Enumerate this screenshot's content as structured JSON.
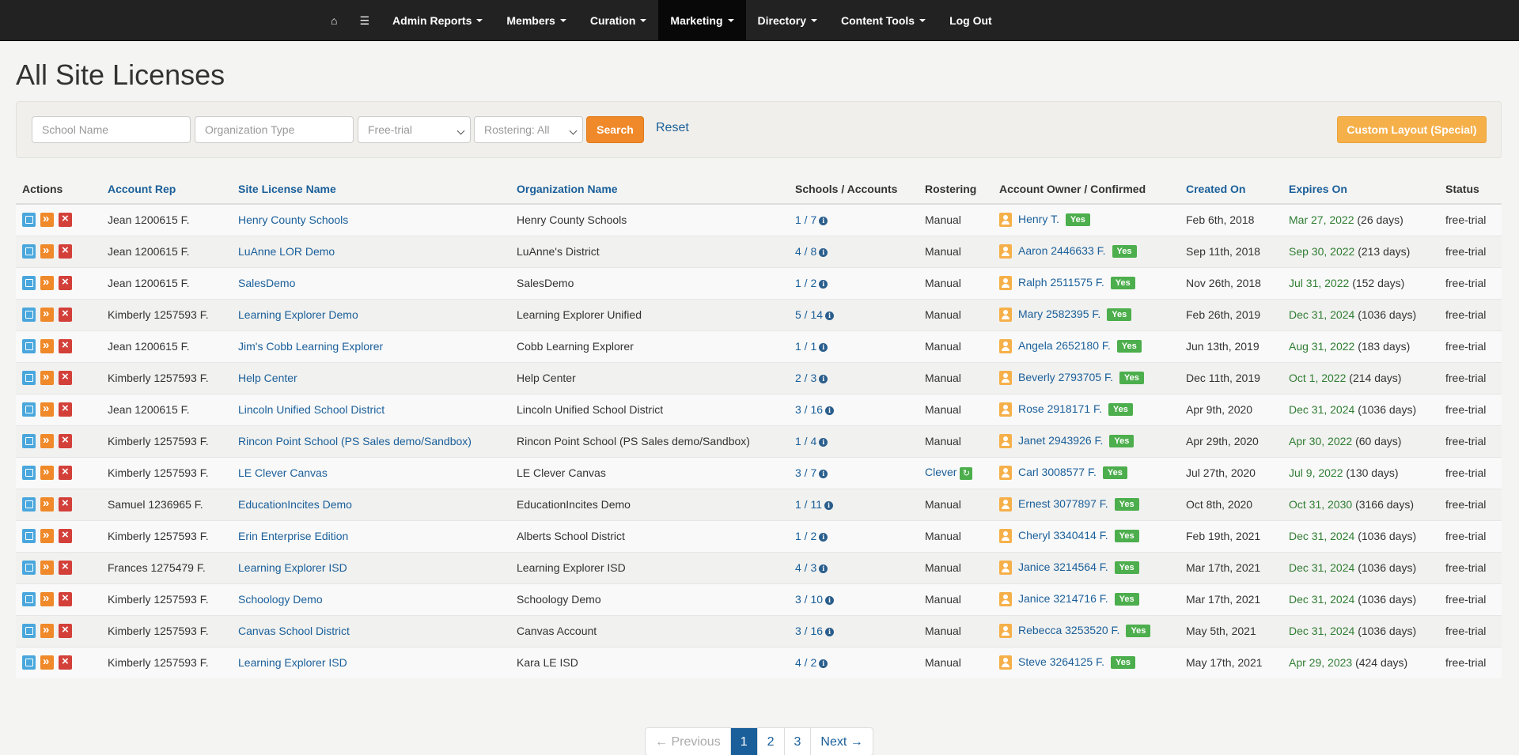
{
  "nav": {
    "home_icon": "home-icon",
    "list_icon": "list-icon",
    "items": [
      {
        "label": "Admin Reports"
      },
      {
        "label": "Members"
      },
      {
        "label": "Curation"
      },
      {
        "label": "Marketing"
      },
      {
        "label": "Directory"
      },
      {
        "label": "Content Tools"
      },
      {
        "label": "Log Out"
      }
    ]
  },
  "page": {
    "title": "All Site Licenses"
  },
  "filters": {
    "school_placeholder": "School Name",
    "org_type_placeholder": "Organization Type",
    "license_type_value": "Free-trial",
    "rostering_value": "Rostering: All",
    "search_label": "Search",
    "reset_label": "Reset",
    "custom_layout_label": "Custom Layout (Special)"
  },
  "table": {
    "headers": {
      "actions": "Actions",
      "account_rep": "Account Rep",
      "site_license_name": "Site License Name",
      "organization_name": "Organization Name",
      "schools_accounts": "Schools / Accounts",
      "rostering": "Rostering",
      "account_owner": "Account Owner / Confirmed",
      "created_on": "Created On",
      "expires_on": "Expires On",
      "status": "Status"
    },
    "rows": [
      {
        "rep": "Jean 1200615 F.",
        "license": "Henry County Schools",
        "org": "Henry County Schools",
        "counts": "1 / 7",
        "rostering": "Manual",
        "owner": "Henry T.",
        "confirmed": "Yes",
        "created": "Feb 6th, 2018",
        "expires": "Mar 27, 2022",
        "days": "(26 days)",
        "status": "free-trial"
      },
      {
        "rep": "Jean 1200615 F.",
        "license": "LuAnne LOR Demo",
        "org": "LuAnne's District",
        "counts": "4 / 8",
        "rostering": "Manual",
        "owner": "Aaron 2446633 F.",
        "confirmed": "Yes",
        "created": "Sep 11th, 2018",
        "expires": "Sep 30, 2022",
        "days": "(213 days)",
        "status": "free-trial"
      },
      {
        "rep": "Jean 1200615 F.",
        "license": "SalesDemo",
        "org": "SalesDemo",
        "counts": "1 / 2",
        "rostering": "Manual",
        "owner": "Ralph 2511575 F.",
        "confirmed": "Yes",
        "created": "Nov 26th, 2018",
        "expires": "Jul 31, 2022",
        "days": "(152 days)",
        "status": "free-trial"
      },
      {
        "rep": "Kimberly 1257593 F.",
        "license": "Learning Explorer Demo",
        "org": "Learning Explorer Unified",
        "counts": "5 / 14",
        "rostering": "Manual",
        "owner": "Mary 2582395 F.",
        "confirmed": "Yes",
        "created": "Feb 26th, 2019",
        "expires": "Dec 31, 2024",
        "days": "(1036 days)",
        "status": "free-trial"
      },
      {
        "rep": "Jean 1200615 F.",
        "license": "Jim's Cobb Learning Explorer",
        "org": "Cobb Learning Explorer",
        "counts": "1 / 1",
        "rostering": "Manual",
        "owner": "Angela 2652180 F.",
        "confirmed": "Yes",
        "created": "Jun 13th, 2019",
        "expires": "Aug 31, 2022",
        "days": "(183 days)",
        "status": "free-trial"
      },
      {
        "rep": "Kimberly 1257593 F.",
        "license": "Help Center",
        "org": "Help Center",
        "counts": "2 / 3",
        "rostering": "Manual",
        "owner": "Beverly 2793705 F.",
        "confirmed": "Yes",
        "created": "Dec 11th, 2019",
        "expires": "Oct 1, 2022",
        "days": "(214 days)",
        "status": "free-trial"
      },
      {
        "rep": "Jean 1200615 F.",
        "license": "Lincoln Unified School District",
        "org": "Lincoln Unified School District",
        "counts": "3 / 16",
        "rostering": "Manual",
        "owner": "Rose 2918171 F.",
        "confirmed": "Yes",
        "created": "Apr 9th, 2020",
        "expires": "Dec 31, 2024",
        "days": "(1036 days)",
        "status": "free-trial"
      },
      {
        "rep": "Kimberly 1257593 F.",
        "license": "Rincon Point School (PS Sales demo/Sandbox)",
        "org": "Rincon Point School (PS Sales demo/Sandbox)",
        "counts": "1 / 4",
        "rostering": "Manual",
        "owner": "Janet 2943926 F.",
        "confirmed": "Yes",
        "created": "Apr 29th, 2020",
        "expires": "Apr 30, 2022",
        "days": "(60 days)",
        "status": "free-trial"
      },
      {
        "rep": "Kimberly 1257593 F.",
        "license": "LE Clever Canvas",
        "org": "LE Clever Canvas",
        "counts": "3 / 7",
        "rostering": "Clever",
        "owner": "Carl 3008577 F.",
        "confirmed": "Yes",
        "created": "Jul 27th, 2020",
        "expires": "Jul 9, 2022",
        "days": "(130 days)",
        "status": "free-trial"
      },
      {
        "rep": "Samuel 1236965 F.",
        "license": "EducationIncites Demo",
        "org": "EducationIncites Demo",
        "counts": "1 / 11",
        "rostering": "Manual",
        "owner": "Ernest 3077897 F.",
        "confirmed": "Yes",
        "created": "Oct 8th, 2020",
        "expires": "Oct 31, 2030",
        "days": "(3166 days)",
        "status": "free-trial"
      },
      {
        "rep": "Kimberly 1257593 F.",
        "license": "Erin Enterprise Edition",
        "org": "Alberts School District",
        "counts": "1 / 2",
        "rostering": "Manual",
        "owner": "Cheryl 3340414 F.",
        "confirmed": "Yes",
        "created": "Feb 19th, 2021",
        "expires": "Dec 31, 2024",
        "days": "(1036 days)",
        "status": "free-trial"
      },
      {
        "rep": "Frances 1275479 F.",
        "license": "Learning Explorer ISD",
        "org": "Learning Explorer ISD",
        "counts": "4 / 3",
        "rostering": "Manual",
        "owner": "Janice 3214564 F.",
        "confirmed": "Yes",
        "created": "Mar 17th, 2021",
        "expires": "Dec 31, 2024",
        "days": "(1036 days)",
        "status": "free-trial"
      },
      {
        "rep": "Kimberly 1257593 F.",
        "license": "Schoology Demo",
        "org": "Schoology Demo",
        "counts": "3 / 10",
        "rostering": "Manual",
        "owner": "Janice 3214716 F.",
        "confirmed": "Yes",
        "created": "Mar 17th, 2021",
        "expires": "Dec 31, 2024",
        "days": "(1036 days)",
        "status": "free-trial"
      },
      {
        "rep": "Kimberly 1257593 F.",
        "license": "Canvas School District",
        "org": "Canvas Account",
        "counts": "3 / 16",
        "rostering": "Manual",
        "owner": "Rebecca 3253520 F.",
        "confirmed": "Yes",
        "created": "May 5th, 2021",
        "expires": "Dec 31, 2024",
        "days": "(1036 days)",
        "status": "free-trial"
      },
      {
        "rep": "Kimberly 1257593 F.",
        "license": "Learning Explorer ISD",
        "org": "Kara LE ISD",
        "counts": "4 / 2",
        "rostering": "Manual",
        "owner": "Steve 3264125 F.",
        "confirmed": "Yes",
        "created": "May 17th, 2021",
        "expires": "Apr 29, 2023",
        "days": "(424 days)",
        "status": "free-trial"
      }
    ]
  },
  "pagination": {
    "previous": "← Previous",
    "pages": [
      "1",
      "2",
      "3"
    ],
    "current": "1",
    "next": "Next →"
  },
  "colors": {
    "navbar_bg": "#222222",
    "link": "#1a5f9a",
    "search_button": "#f0892a",
    "custom_button": "#f6b04a",
    "yes_badge": "#4cae4c",
    "expires_text": "#2f7d32",
    "delete_action": "#d3403a",
    "edit_action": "#4aa7dd"
  }
}
